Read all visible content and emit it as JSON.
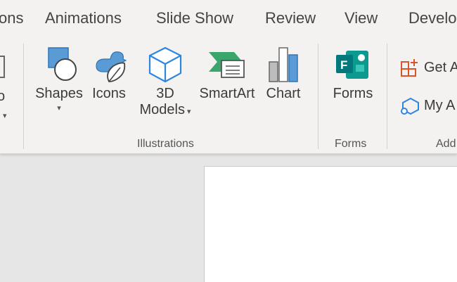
{
  "tabs": [
    {
      "id": "transitions",
      "label": "ons"
    },
    {
      "id": "animations",
      "label": "Animations"
    },
    {
      "id": "slideshow",
      "label": "Slide Show"
    },
    {
      "id": "review",
      "label": "Review"
    },
    {
      "id": "view",
      "label": "View"
    },
    {
      "id": "developer",
      "label": "Develo"
    }
  ],
  "left_partial": {
    "label": "o"
  },
  "illustrations": {
    "group_label": "Illustrations",
    "shapes_label": "Shapes",
    "icons_label": "Icons",
    "models_line1": "3D",
    "models_line2": "Models",
    "smartart_label": "SmartArt",
    "chart_label": "Chart"
  },
  "forms": {
    "group_label": "Forms",
    "forms_label": "Forms"
  },
  "addins": {
    "group_label": "Add",
    "get_addins_label": "Get A",
    "my_addins_label": "My A"
  },
  "colors": {
    "ribbon_bg": "#f3f2f1",
    "accent_blue": "#2e86de",
    "smartart_green": "#3aa66b",
    "forms_teal": "#03787c",
    "addin_orange": "#d9542a"
  }
}
